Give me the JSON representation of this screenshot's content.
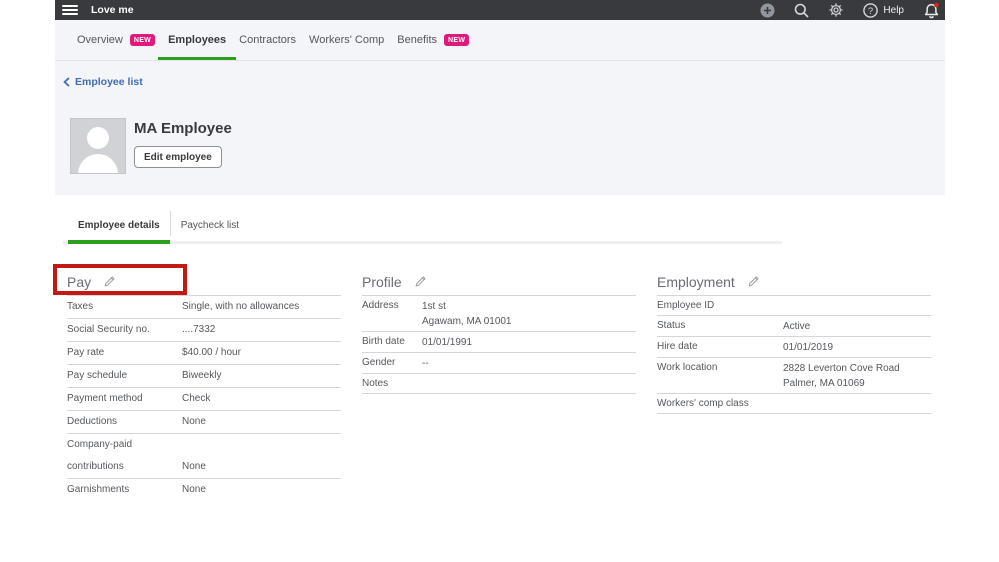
{
  "topbar": {
    "title": "Love me",
    "help_label": "Help"
  },
  "main_tabs": [
    {
      "label": "Overview",
      "badge": "NEW"
    },
    {
      "label": "Employees"
    },
    {
      "label": "Contractors"
    },
    {
      "label": "Workers' Comp"
    },
    {
      "label": "Benefits",
      "badge": "NEW"
    }
  ],
  "back_link_label": "Employee list",
  "employee_header": {
    "name": "MA Employee",
    "edit_button_label": "Edit employee"
  },
  "detail_tabs": [
    {
      "label": "Employee details"
    },
    {
      "label": "Paycheck list"
    }
  ],
  "sections": {
    "pay": {
      "title": "Pay",
      "rows": [
        {
          "label": "Taxes",
          "value": "Single, with no allowances"
        },
        {
          "label": "Social Security no.",
          "value": "....7332"
        },
        {
          "label": "Pay rate",
          "value": "$40.00 / hour"
        },
        {
          "label": "Pay schedule",
          "value": "Biweekly"
        },
        {
          "label": "Payment method",
          "value": "Check"
        },
        {
          "label": "Deductions",
          "value": "None"
        },
        {
          "label": "Company-paid contributions",
          "value": "None"
        },
        {
          "label": "Garnishments",
          "value": "None"
        }
      ]
    },
    "profile": {
      "title": "Profile",
      "rows": [
        {
          "label": "Address",
          "value": [
            "1st st",
            "Agawam, MA 01001"
          ]
        },
        {
          "label": "Birth date",
          "value": "01/01/1991"
        },
        {
          "label": "Gender",
          "value": "--"
        },
        {
          "label": "Notes",
          "value": ""
        }
      ]
    },
    "employment": {
      "title": "Employment",
      "rows": [
        {
          "label": "Employee ID",
          "value": ""
        },
        {
          "label": "Status",
          "value": "Active"
        },
        {
          "label": "Hire date",
          "value": "01/01/2019"
        },
        {
          "label": "Work location",
          "value": [
            "2828 Leverton Cove Road",
            "Palmer, MA 01069"
          ]
        },
        {
          "label": "Workers' comp class",
          "value": ""
        }
      ]
    }
  },
  "highlight": {
    "target": "pay-section-title",
    "color": "#c21a12"
  },
  "colors": {
    "accent_green": "#2ca01c",
    "badge_pink": "#e0197d",
    "topbar_bg": "#393a3d",
    "link_blue": "#3f6cb3",
    "highlight_red": "#c21a12"
  }
}
